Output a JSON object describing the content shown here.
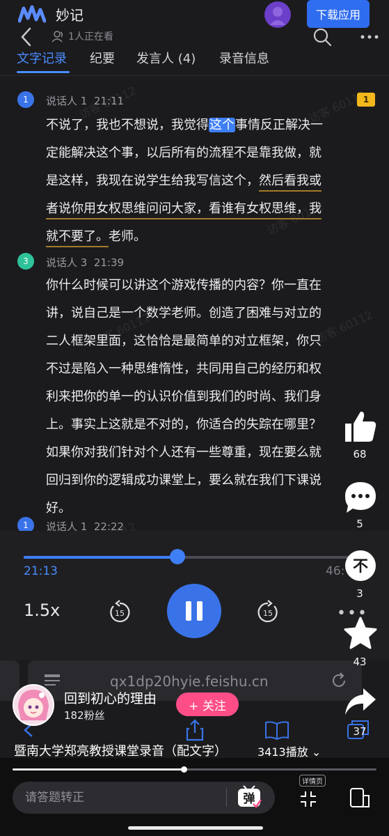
{
  "app": {
    "name": "妙记",
    "download_label": "下载应用",
    "viewers": "1人正在看"
  },
  "tabs": [
    {
      "label": "文字记录",
      "active": true
    },
    {
      "label": "纪要",
      "active": false
    },
    {
      "label": "发言人 (4)",
      "active": false
    },
    {
      "label": "录音信息",
      "active": false
    }
  ],
  "comment_flag": "1",
  "transcript": [
    {
      "badge": "1",
      "badge_color": "#3a73e8",
      "speaker": "说话人 1",
      "time": "21:11",
      "lines": [
        [
          "不说了，我也不想说，我觉得",
          "这个",
          "事情反正解决一"
        ],
        [
          "定能解决这个事，以后所有的流程不是靠我做，就"
        ],
        [
          "是这样，我现在说学生给我写信这个，",
          "然后看我或"
        ],
        [
          "者说你用女权思维问问大家，看谁有女权思维，我"
        ],
        [
          "就不要了。",
          "老师。"
        ]
      ]
    },
    {
      "badge": "3",
      "badge_color": "#2ec29a",
      "speaker": "说话人 3",
      "time": "21:39",
      "lines": [
        "你什么时候可以讲这个游戏传播的内容？你一直在",
        "讲，说自己是一个数学老师。创造了困难与对立的",
        "二人框架里面，这恰恰是最简单的对立框架，你只",
        "不过是陷入一种思维惰性，共同用自己的经历和权",
        "利来把你的单一的认识价值到我们的时尚、我们身",
        "上。事实上这就是不对的，你适合的失踪在哪里？",
        "如果你对我们针对个人还有一些尊重，现在要么就",
        "回归到你的逻辑成功课堂上，要么就在我们下课说",
        "好。"
      ]
    },
    {
      "badge": "1",
      "badge_color": "#3a73e8",
      "speaker": "说话人 1",
      "time": "22:22"
    }
  ],
  "watermark": "访客 60112",
  "player": {
    "current": "21:13",
    "total": "46:",
    "speed": "1.5x",
    "skip_seconds": "15",
    "progress": 0.47
  },
  "browser": {
    "url": "qx1dp20hyie.feishu.cn"
  },
  "actions": [
    {
      "icon": "thumbs-up-icon",
      "count": "68"
    },
    {
      "icon": "comment-bubble-icon",
      "count": "5"
    },
    {
      "icon": "dislike-icon",
      "glyph": "不",
      "count": "3"
    },
    {
      "icon": "star-icon",
      "count": "43"
    },
    {
      "icon": "share-arrow-icon",
      "count": "37"
    }
  ],
  "author": {
    "name": "回到初心的理由",
    "fans": "182粉丝",
    "follow_label": "+ 关注"
  },
  "video": {
    "title": "暨南大学郑亮教授课堂录音（配文字）",
    "plays": "3413播放"
  },
  "bottom": {
    "comment_placeholder": "请答题转正",
    "danmu_glyph": "弹",
    "detail_label": "详情页",
    "seek_progress": 0.47
  },
  "colors": {
    "accent": "#3f7ff5",
    "follow": "#ff4d87",
    "underline": "#a27c2b",
    "flag": "#f3b81b"
  }
}
